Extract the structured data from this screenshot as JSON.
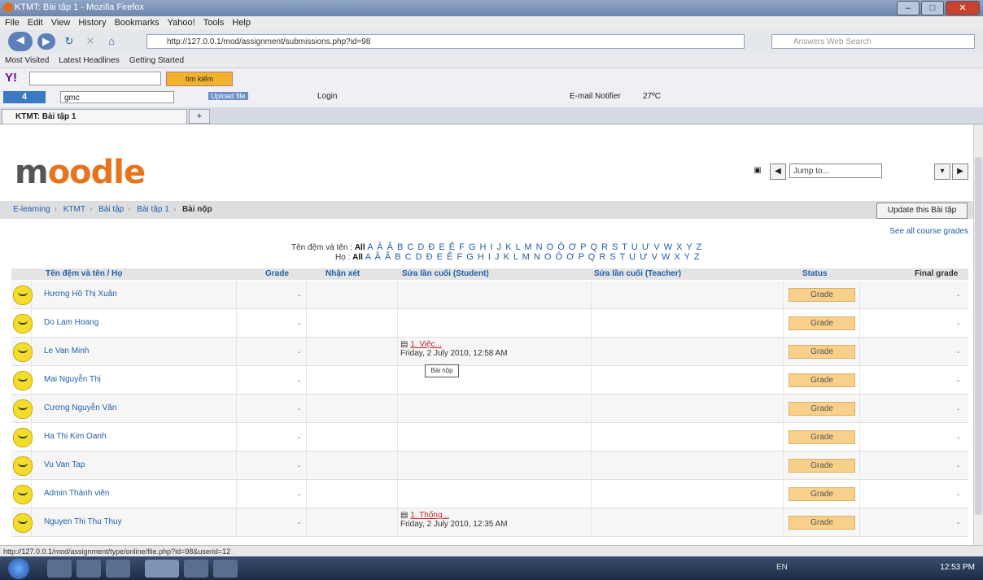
{
  "window": {
    "title": "KTMT: Bài tập 1 - Mozilla Firefox"
  },
  "menu": [
    "File",
    "Edit",
    "View",
    "History",
    "Bookmarks",
    "Yahoo!",
    "Tools",
    "Help"
  ],
  "nav": {
    "url": "http://127.0.0.1/mod/assignment/submissions.php?id=98",
    "search_placeholder": "Answers Web Search"
  },
  "bookmarks": [
    "Most Visited",
    "Latest Headlines",
    "Getting Started"
  ],
  "yahoo": {
    "logo": "Y!",
    "search_button": "tìm kiếm"
  },
  "toolbar2": {
    "logo": "4",
    "input_value": "gmc",
    "upload": "Upload file",
    "login": "Login",
    "email": "E-mail Notifier",
    "temp": "27ºC"
  },
  "tab": {
    "label": "KTMT: Bài tập 1",
    "new_tab": "+"
  },
  "moodle": {
    "logo_m": "m",
    "logo_rest": "oodle",
    "jump_to": "Jump to...",
    "breadcrumb": [
      "E-learning",
      "KTMT",
      "Bài tập",
      "Bài tập 1",
      "Bài nộp"
    ],
    "update_button": "Update this Bài tập",
    "see_all": "See all course grades",
    "filter1_label": "Tên đệm và tên :",
    "filter1_all": "All",
    "filter1_letters": "A Ă Â B C D Đ E Ê F G H I J K L M N O Ô Ơ P Q R S T U Ư V W X Y Z",
    "filter2_label": "Họ :",
    "filter2_all": "All",
    "filter2_letters": "A Ă Â B C D Đ E Ê F G H I J K L M N O Ô Ơ P Q R S T U Ư V W X Y Z",
    "columns": {
      "name": "Tên đệm và tên / Họ",
      "grade": "Grade",
      "comment": "Nhận xét",
      "student": "Sửa lần cuối (Student)",
      "teacher": "Sửa lần cuối (Teacher)",
      "status": "Status",
      "final": "Final grade"
    },
    "rows": [
      {
        "name": "Hương Hồ Thị Xuân",
        "grade": "-",
        "sub_link": "",
        "sub_date": "",
        "status": "Grade",
        "final": "-"
      },
      {
        "name": "Do Lam Hoang",
        "grade": "-",
        "sub_link": "",
        "sub_date": "",
        "status": "Grade",
        "final": "-"
      },
      {
        "name": "Le Van Minh",
        "grade": "-",
        "sub_link": "1. Việc...",
        "sub_date": "Friday, 2 July 2010, 12:58 AM",
        "status": "Grade",
        "final": "-"
      },
      {
        "name": "Mai Nguyễn Thị",
        "grade": "-",
        "sub_link": "",
        "sub_date": "",
        "status": "Grade",
        "final": "-"
      },
      {
        "name": "Cương Nguyễn Văn",
        "grade": "-",
        "sub_link": "",
        "sub_date": "",
        "status": "Grade",
        "final": "-"
      },
      {
        "name": "Ha Thi Kim Oanh",
        "grade": "-",
        "sub_link": "",
        "sub_date": "",
        "status": "Grade",
        "final": "-"
      },
      {
        "name": "Vu Van Tap",
        "grade": "-",
        "sub_link": "",
        "sub_date": "",
        "status": "Grade",
        "final": "-"
      },
      {
        "name": "Admin Thành viên",
        "grade": "-",
        "sub_link": "",
        "sub_date": "",
        "status": "Grade",
        "final": "-"
      },
      {
        "name": "Nguyen Thi Thu Thuy",
        "grade": "-",
        "sub_link": "1. Thống...",
        "sub_date": "Friday, 2 July 2010, 12:35 AM",
        "status": "Grade",
        "final": "-"
      }
    ],
    "tooltip": "Bài nộp"
  },
  "statusbar": "http://127.0.0.1/mod/assignment/type/online/file.php?id=98&userid=12",
  "taskbar": {
    "clock": "12:53 PM",
    "lang": "EN"
  }
}
